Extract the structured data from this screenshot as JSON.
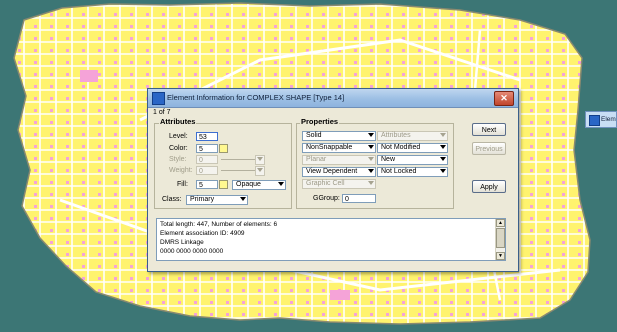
{
  "colors": {
    "background": "#3c7675",
    "map_fill": "#fff36e",
    "map_white": "#ffffff",
    "map_pink": "#f5a3d8",
    "map_outline": "#8a8a70",
    "titlebar": "#9cbfe4"
  },
  "dialog": {
    "title": "Element Information for COMPLEX SHAPE [Type 14]",
    "counter": "1 of 7",
    "close_icon": "close-icon",
    "attributes": {
      "heading": "Attributes",
      "level_label": "Level:",
      "level_value": "53",
      "color_label": "Color:",
      "color_value": "5",
      "style_label": "Style:",
      "style_value": "0",
      "weight_label": "Weight:",
      "weight_value": "0",
      "fill_label": "Fill:",
      "fill_value": "5",
      "fill_mode": "Opaque",
      "class_label": "Class:",
      "class_value": "Primary"
    },
    "properties": {
      "heading": "Properties",
      "row1_left": "Solid",
      "row1_right": "Attributes",
      "row2_left": "NonSnappable",
      "row2_right": "Not Modified",
      "row3_left": "Planar",
      "row3_right": "New",
      "row4_left": "View Dependent",
      "row4_right": "Not Locked",
      "row5_left": "Graphic Cell",
      "ggroup_label": "GGroup:",
      "ggroup_value": "0"
    },
    "buttons": {
      "next": "Next",
      "previous": "Previous",
      "apply": "Apply"
    },
    "info_lines": [
      "Total length: 447, Number of elements: 6",
      "Element association ID: 4909",
      "DMRS Linkage",
      " 0000 0000 0000 0000"
    ]
  },
  "side_window": {
    "label": "Elem"
  }
}
